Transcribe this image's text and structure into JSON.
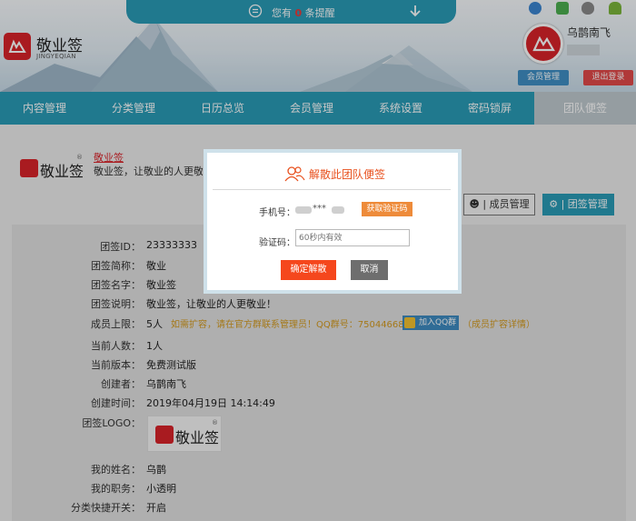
{
  "header": {
    "notice_prefix": "您有",
    "notice_count": "0",
    "notice_suffix": "条提醒",
    "logo_name": "敬业签",
    "logo_sub": "JINGYEQIAN",
    "username": "乌鹊南飞",
    "member_button": "会员管理",
    "logout_button": "退出登录",
    "browser_icons": [
      "ie-icon",
      "windows-icon",
      "apple-icon",
      "android-icon"
    ]
  },
  "nav": {
    "items": [
      "内容管理",
      "分类管理",
      "日历总览",
      "会员管理",
      "系统设置",
      "密码锁屏",
      "团队便签"
    ],
    "active": "团队便签"
  },
  "team": {
    "logo_name": "敬业签",
    "logo_reg": "®",
    "title": "敬业签",
    "desc": "敬业签，让敬业的人更敬业！",
    "members_button": "成员管理",
    "settings_button": "团签管理"
  },
  "info": {
    "rows": [
      {
        "label": "团签ID：",
        "value": "23333333"
      },
      {
        "label": "团签简称：",
        "value": "敬业"
      },
      {
        "label": "团签名字：",
        "value": "敬业签"
      },
      {
        "label": "团签说明：",
        "value": "敬业签，让敬业的人更敬业！"
      },
      {
        "label": "成员上限：",
        "value": "5人"
      },
      {
        "label": "当前人数：",
        "value": "1人"
      },
      {
        "label": "当前版本：",
        "value": "免费测试版"
      },
      {
        "label": "创建者：",
        "value": "乌鹊南飞"
      },
      {
        "label": "创建时间：",
        "value": "2019年04月19日 14:14:49"
      },
      {
        "label": "团签LOGO：",
        "value": ""
      },
      {
        "label": "我的姓名：",
        "value": "乌鹊"
      },
      {
        "label": "我的职务：",
        "value": "小透明"
      },
      {
        "label": "分类快捷开关：",
        "value": "开启"
      }
    ],
    "expand_note": "如需扩容，请在官方群联系管理员！QQ群号：750446687",
    "qq_button": "加入QQ群",
    "expand_detail": "（成员扩容详情）"
  },
  "dialog": {
    "title": "解散此团队便签",
    "phone_label": "手机号：",
    "phone_masked": "***",
    "get_code_button": "获取验证码",
    "code_label": "验证码：",
    "code_placeholder": "60秒内有效",
    "confirm_button": "确定解散",
    "cancel_button": "取消"
  },
  "colors": {
    "accent": "#2a9bb6",
    "brand_red": "#d9232a",
    "danger": "#f5471d",
    "warn": "#ee8b3a",
    "note": "#d49a1f"
  }
}
